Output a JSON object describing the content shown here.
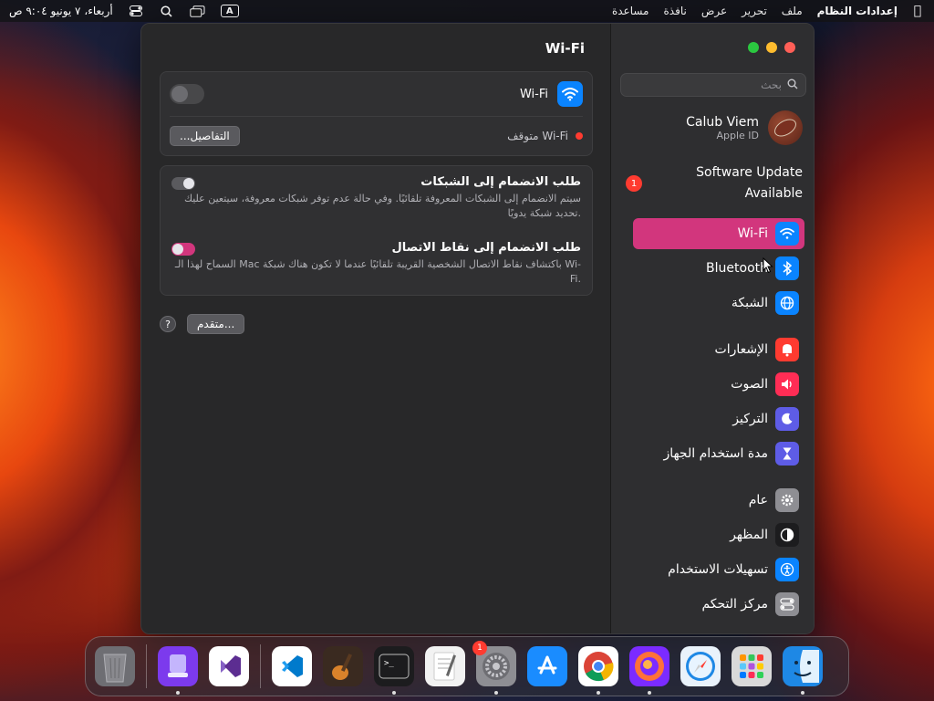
{
  "menubar": {
    "app_name": "إعدادات النظام",
    "items": [
      "ملف",
      "تحرير",
      "عرض",
      "نافذة",
      "مساعدة"
    ],
    "clock": "أربعاء، ٧ يونيو  ٩:٠٤ ص",
    "input_indicator": "A"
  },
  "sidebar": {
    "search_placeholder": "بحث",
    "profile": {
      "name": "Calub Viem",
      "subtitle": "Apple ID"
    },
    "update": {
      "line1": "Software Update",
      "line2": "Available",
      "badge": "1"
    },
    "items": [
      {
        "label": "Wi-Fi",
        "icon": "wifi-icon",
        "color": "#0a84ff",
        "active": true
      },
      {
        "label": "Bluetooth",
        "icon": "bluetooth-icon",
        "color": "#0a84ff"
      },
      {
        "label": "الشبكة",
        "icon": "globe-icon",
        "color": "#0a84ff"
      },
      {
        "label": "الإشعارات",
        "icon": "bell-icon",
        "color": "#ff3b30"
      },
      {
        "label": "الصوت",
        "icon": "speaker-icon",
        "color": "#ff2d55"
      },
      {
        "label": "التركيز",
        "icon": "moon-icon",
        "color": "#5e5ce6"
      },
      {
        "label": "مدة استخدام الجهاز",
        "icon": "hourglass-icon",
        "color": "#5e5ce6"
      },
      {
        "label": "عام",
        "icon": "gear-icon",
        "color": "#8e8e93"
      },
      {
        "label": "المظهر",
        "icon": "appearance-icon",
        "color": "#1c1c1e"
      },
      {
        "label": "تسهيلات الاستخدام",
        "icon": "accessibility-icon",
        "color": "#0a84ff"
      },
      {
        "label": "مركز التحكم",
        "icon": "control-center-icon",
        "color": "#8e8e93"
      }
    ]
  },
  "content": {
    "title": "Wi-Fi",
    "wifi_label": "Wi-Fi",
    "status_text": "Wi-Fi متوقف",
    "details_button": "التفاصيل...",
    "ask_networks": {
      "title": "طلب الانضمام إلى الشبكات",
      "desc": "سيتم الانضمام إلى الشبكات المعروفة تلقائيًا. وفي حالة عدم توفر شبكات معروفة، سيتعين عليك تحديد شبكة يدويًا."
    },
    "ask_hotspots": {
      "title": "طلب الانضمام إلى نقاط الاتصال",
      "desc": "السماح لهذا الـ Mac باكتشاف نقاط الاتصال الشخصية القريبة تلقائيًا عندما لا تكون هناك شبكة Wi-Fi."
    },
    "advanced_button": "متقدم...",
    "help_label": "?"
  },
  "dock": {
    "items": [
      {
        "name": "finder",
        "color": "#1e88e5",
        "running": true
      },
      {
        "name": "launchpad",
        "color": "#d9d9d9",
        "running": false
      },
      {
        "name": "safari",
        "color": "#e9f2fb",
        "running": false
      },
      {
        "name": "firefox",
        "color": "#7b2bff",
        "running": true
      },
      {
        "name": "chrome",
        "color": "#ffffff",
        "running": true
      },
      {
        "name": "app-store",
        "color": "#1a8cff",
        "running": false
      },
      {
        "name": "system-settings",
        "color": "#8e8e93",
        "running": true,
        "badge": "1"
      },
      {
        "name": "textedit",
        "color": "#f2f2f2",
        "running": false
      },
      {
        "name": "terminal",
        "color": "#1c1c1e",
        "running": true
      },
      {
        "name": "garageband",
        "color": "#3a2a20",
        "running": false
      },
      {
        "name": "vscode",
        "color": "#ffffff",
        "running": false
      },
      {
        "name": "visual-studio",
        "color": "#ffffff",
        "running": false
      },
      {
        "name": "simulator",
        "color": "#7c3aed",
        "running": true
      },
      {
        "name": "trash",
        "color": "#6e6e73",
        "running": false
      }
    ]
  }
}
